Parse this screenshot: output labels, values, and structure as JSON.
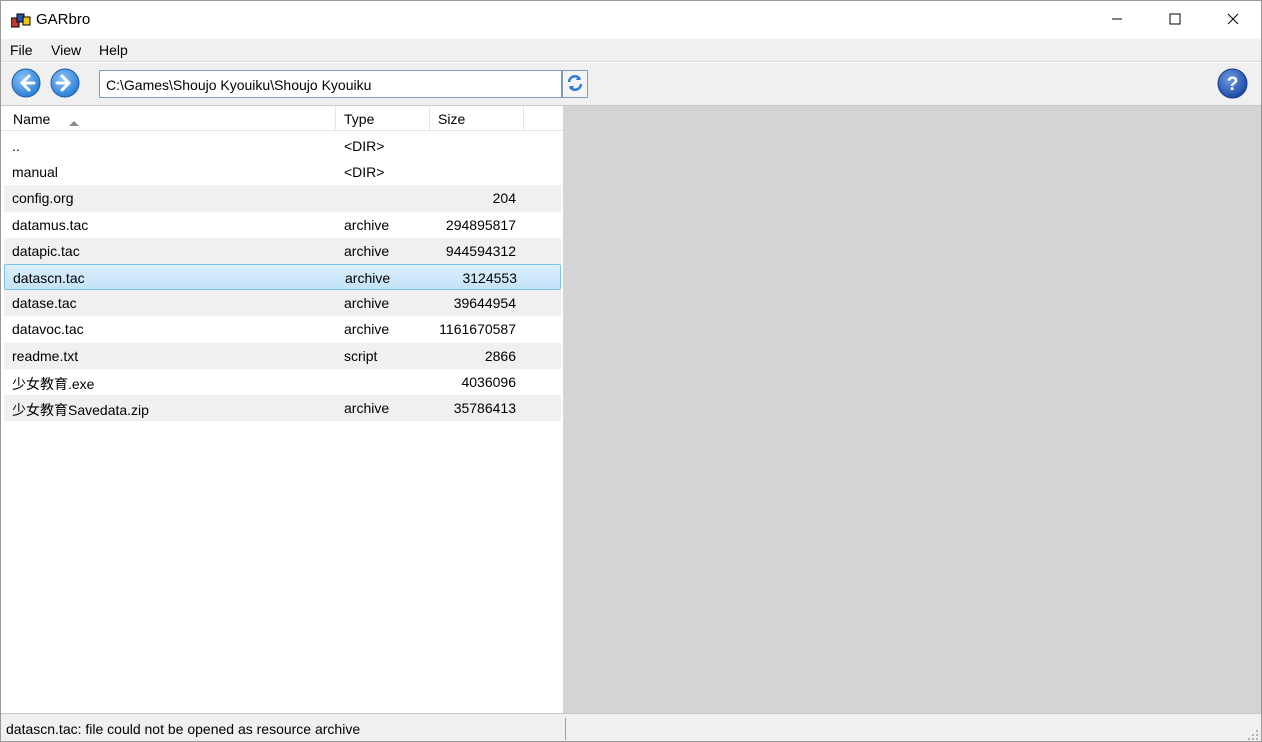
{
  "window": {
    "title": "GARbro",
    "minimize_icon": "minimize-icon",
    "maximize_icon": "maximize-icon",
    "close_icon": "close-icon"
  },
  "menu": {
    "items": [
      "File",
      "View",
      "Help"
    ]
  },
  "toolbar": {
    "back_icon": "arrow-left-icon",
    "forward_icon": "arrow-right-icon",
    "path": "C:\\Games\\Shoujo Kyouiku\\Shoujo Kyouiku",
    "refresh_icon": "refresh-icon",
    "help_icon": "help-icon"
  },
  "filelist": {
    "columns": {
      "name": "Name",
      "type": "Type",
      "size": "Size"
    },
    "sort": "Name ascending",
    "rows": [
      {
        "name": "..",
        "type": "<DIR>",
        "size": ""
      },
      {
        "name": "manual",
        "type": "<DIR>",
        "size": ""
      },
      {
        "name": "config.org",
        "type": "",
        "size": "204"
      },
      {
        "name": "datamus.tac",
        "type": "archive",
        "size": "294895817"
      },
      {
        "name": "datapic.tac",
        "type": "archive",
        "size": "944594312"
      },
      {
        "name": "datascn.tac",
        "type": "archive",
        "size": "3124553"
      },
      {
        "name": "datase.tac",
        "type": "archive",
        "size": "39644954"
      },
      {
        "name": "datavoc.tac",
        "type": "archive",
        "size": "1161670587"
      },
      {
        "name": "readme.txt",
        "type": "script",
        "size": "2866"
      },
      {
        "name": "少女教育.exe",
        "type": "",
        "size": "4036096"
      },
      {
        "name": "少女教育Savedata.zip",
        "type": "archive",
        "size": "35786413"
      }
    ],
    "selected": "datascn.tac"
  },
  "status": {
    "message": "datascn.tac: file could not be opened as resource archive"
  },
  "colors": {
    "preview_bg": "#d4d4d4",
    "selection": "#c2e3f8",
    "nav_button": "#3a8ee6"
  }
}
